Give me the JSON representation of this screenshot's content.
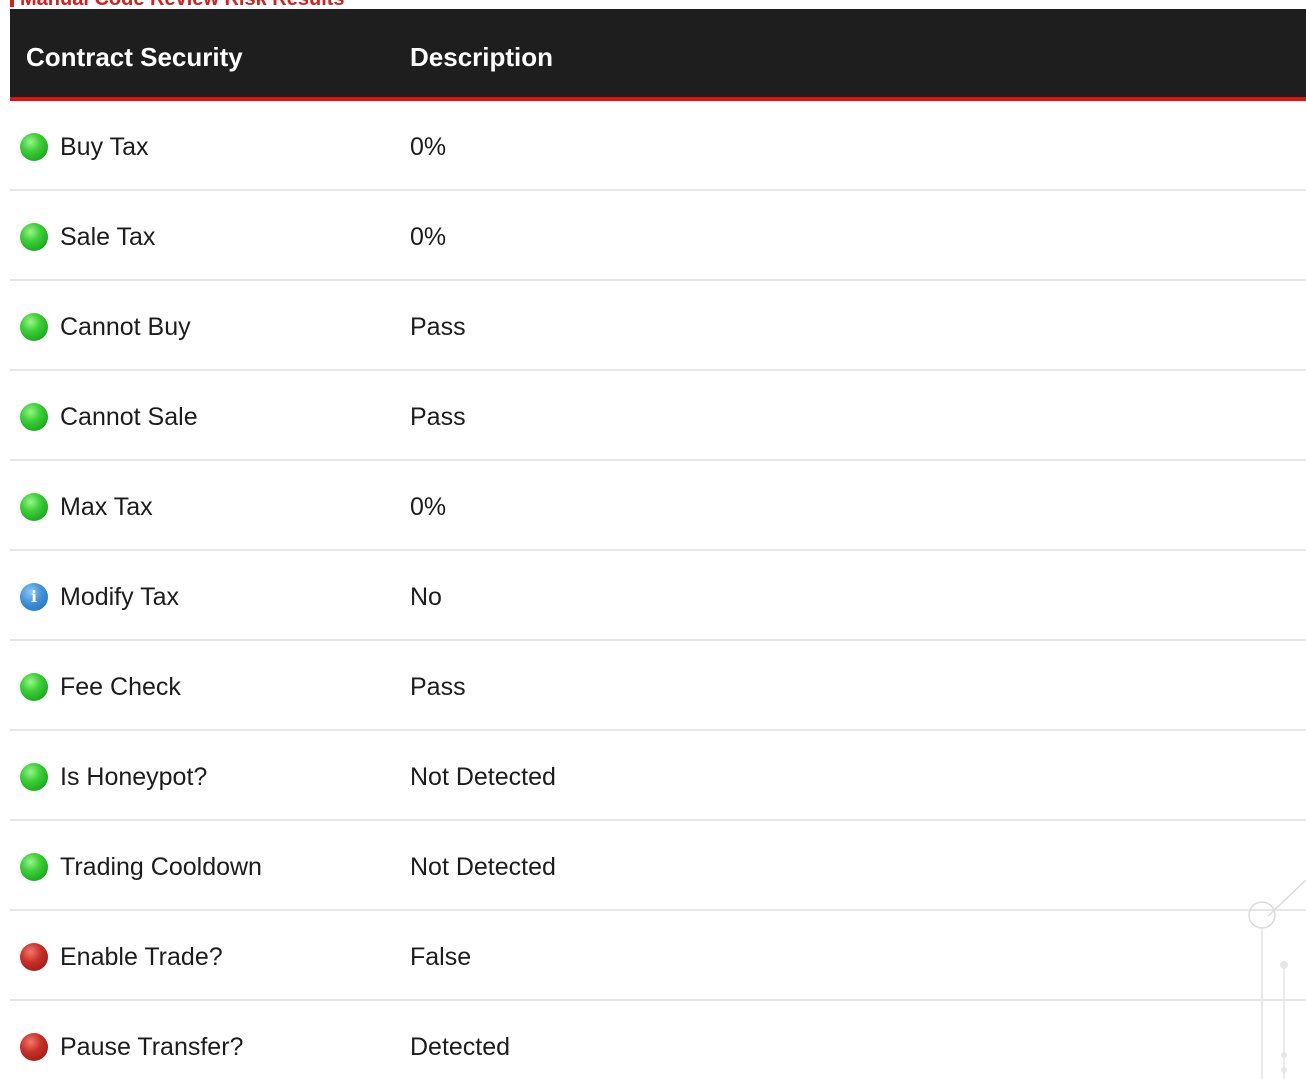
{
  "section_title": "Manual Code Review Risk Results",
  "table": {
    "headers": {
      "contract_security": "Contract Security",
      "description": "Description"
    },
    "rows": [
      {
        "name": "Buy Tax",
        "value": "0%",
        "status": "pass"
      },
      {
        "name": "Sale Tax",
        "value": "0%",
        "status": "pass"
      },
      {
        "name": "Cannot Buy",
        "value": "Pass",
        "status": "pass"
      },
      {
        "name": "Cannot Sale",
        "value": "Pass",
        "status": "pass"
      },
      {
        "name": "Max Tax",
        "value": "0%",
        "status": "pass"
      },
      {
        "name": "Modify Tax",
        "value": "No",
        "status": "info"
      },
      {
        "name": "Fee Check",
        "value": "Pass",
        "status": "pass"
      },
      {
        "name": "Is Honeypot?",
        "value": "Not Detected",
        "status": "pass"
      },
      {
        "name": "Trading Cooldown",
        "value": "Not Detected",
        "status": "pass"
      },
      {
        "name": "Enable Trade?",
        "value": "False",
        "status": "fail"
      },
      {
        "name": "Pause Transfer?",
        "value": "Detected",
        "status": "fail"
      }
    ]
  },
  "icons": {
    "pass": "green-check-dot-icon",
    "fail": "red-alert-dot-icon",
    "info": "info-icon",
    "info_glyph": "i"
  },
  "colors": {
    "header_bg": "#1e1e1e",
    "header_underline": "#e11212",
    "accent": "#d6201f",
    "pass": "#2fbf2f",
    "fail": "#b3231d",
    "info": "#3f90d8",
    "row_divider": "#e6e6e6"
  }
}
